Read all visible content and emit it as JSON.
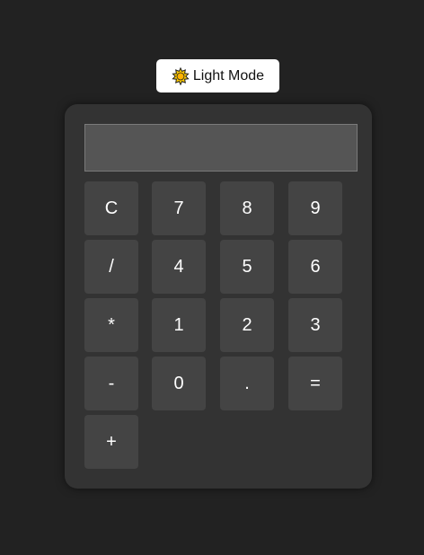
{
  "theme_toggle": {
    "icon": "sun-icon",
    "label": "Light Mode"
  },
  "display": {
    "value": ""
  },
  "keys": [
    "C",
    "7",
    "8",
    "9",
    "/",
    "4",
    "5",
    "6",
    "*",
    "1",
    "2",
    "3",
    "-",
    "0",
    ".",
    "=",
    "+"
  ],
  "colors": {
    "page_background": "#222222",
    "calculator_background": "#333333",
    "key_background": "#444444",
    "display_background": "#555555",
    "toggle_background": "#ffffff",
    "sun_fill": "#ffcc00"
  }
}
